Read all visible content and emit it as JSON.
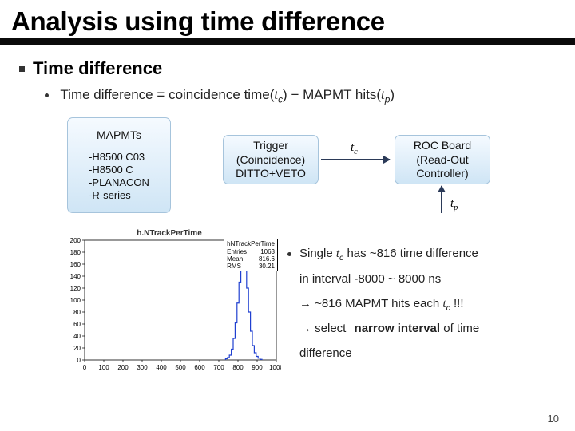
{
  "title": "Analysis using time difference",
  "section_head": "Time difference",
  "formula": {
    "lhs": "Time difference",
    "eq": "=",
    "coinc": "coincidence time",
    "tc": "t",
    "tc_sub": "c",
    "minus": "−",
    "hits": "MAPMT hits",
    "tp": "t",
    "tp_sub": "p"
  },
  "boxes": {
    "mapmts": {
      "title": "MAPMTs",
      "lines": [
        "-H8500 C03",
        "-H8500 C",
        "-PLANACON",
        "-R-series"
      ]
    },
    "trigger": {
      "l1": "Trigger",
      "l2": "(Coincidence)",
      "l3": "DITTO+VETO"
    },
    "roc": {
      "l1": "ROC Board",
      "l2": "(Read-Out",
      "l3": "Controller)"
    }
  },
  "arrow_labels": {
    "tc": "t",
    "tc_sub": "c",
    "tp": "t",
    "tp_sub": "p"
  },
  "chart_data": {
    "type": "bar",
    "title": "h.NTrackPerTime",
    "stats": {
      "name": "hNTrackPerTime",
      "entries": "1063",
      "mean": "816.6",
      "rms": "30.21"
    },
    "xlabel": "",
    "ylabel": "",
    "xlim": [
      0,
      1000
    ],
    "ylim": [
      0,
      200
    ],
    "xticks": [
      0,
      100,
      200,
      300,
      400,
      500,
      600,
      700,
      800,
      900,
      1000
    ],
    "yticks": [
      0,
      20,
      40,
      60,
      80,
      100,
      120,
      140,
      160,
      180,
      200
    ],
    "categories": [
      740,
      750,
      760,
      770,
      780,
      790,
      800,
      810,
      820,
      830,
      840,
      850,
      860,
      870,
      880,
      890,
      900,
      910,
      920
    ],
    "values": [
      2,
      4,
      8,
      18,
      36,
      62,
      95,
      130,
      160,
      190,
      160,
      120,
      80,
      48,
      24,
      12,
      6,
      3,
      1
    ]
  },
  "notes": {
    "line1a": "Single ",
    "line1_tc": "t",
    "line1_tc_sub": "c",
    "line1b": " has ~816 time difference",
    "line2": "in interval -8000 ~ 8000 ns",
    "line3a": "→ ~816 MAPMT hits each ",
    "line3_tc": "t",
    "line3_tc_sub": "c",
    "line3b": " !!!",
    "line4a": "→ select ",
    "line4_bold": "narrow interval",
    "line4b": " of time",
    "line5": "difference"
  },
  "pagenum": "10"
}
